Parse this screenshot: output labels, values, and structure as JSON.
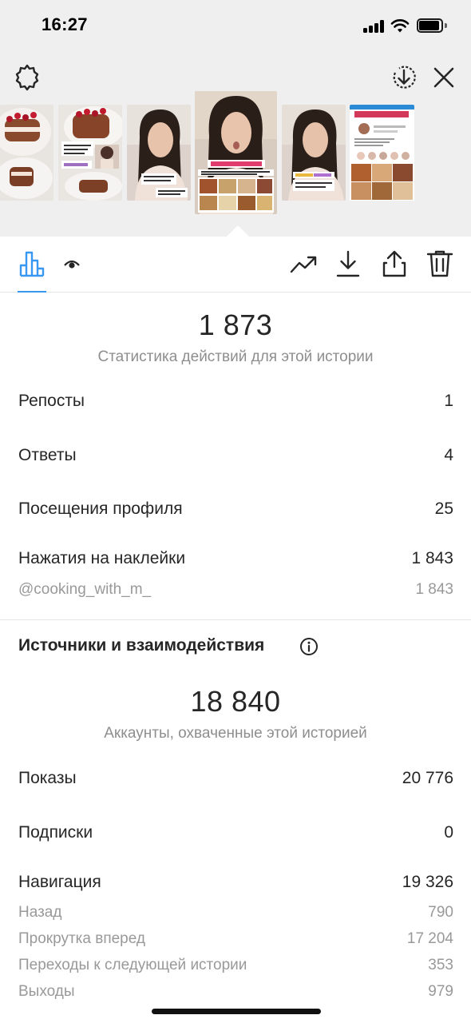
{
  "status_bar": {
    "time": "16:27"
  },
  "colors": {
    "accent": "#3897f0",
    "text": "#262626",
    "muted": "#8e8e8e",
    "top_bg": "#efefef"
  },
  "top_bar": {
    "left_icon": "settings-gear-icon",
    "right_icons": [
      "download-circle-icon",
      "close-icon"
    ]
  },
  "thumbnails": [
    {
      "name": "story-thumb-1",
      "description_icon": "dessert-photo"
    },
    {
      "name": "story-thumb-2",
      "description_icon": "dessert-collage"
    },
    {
      "name": "story-thumb-3",
      "description_icon": "woman-selfie"
    },
    {
      "name": "story-thumb-4-selected",
      "description_icon": "woman-with-food-collage"
    },
    {
      "name": "story-thumb-5",
      "description_icon": "woman-selfie"
    },
    {
      "name": "story-thumb-6",
      "description_icon": "profile-screenshot"
    }
  ],
  "toolbar": {
    "left": [
      "bar-chart-icon",
      "eye-icon"
    ],
    "right": [
      "trending-up-icon",
      "download-icon",
      "share-icon",
      "trash-icon"
    ]
  },
  "interactions": {
    "total": "1 873",
    "caption": "Статистика действий для этой истории",
    "rows": [
      {
        "label": "Репосты",
        "value": "1"
      },
      {
        "label": "Ответы",
        "value": "4"
      },
      {
        "label": "Посещения профиля",
        "value": "25"
      },
      {
        "label": "Нажатия на наклейки",
        "value": "1 843"
      }
    ],
    "sticker": {
      "label": "@cooking_with_m_",
      "value": "1 843"
    }
  },
  "discovery": {
    "title": "Источники и взаимодействия",
    "total": "18 840",
    "caption": "Аккаунты, охваченные этой историей",
    "rows": [
      {
        "label": "Показы",
        "value": "20 776"
      },
      {
        "label": "Подписки",
        "value": "0"
      },
      {
        "label": "Навигация",
        "value": "19 326"
      }
    ],
    "navigation": [
      {
        "label": "Назад",
        "value": "790"
      },
      {
        "label": "Прокрутка вперед",
        "value": "17 204"
      },
      {
        "label": "Переходы к следующей истории",
        "value": "353"
      },
      {
        "label": "Выходы",
        "value": "979"
      }
    ]
  }
}
